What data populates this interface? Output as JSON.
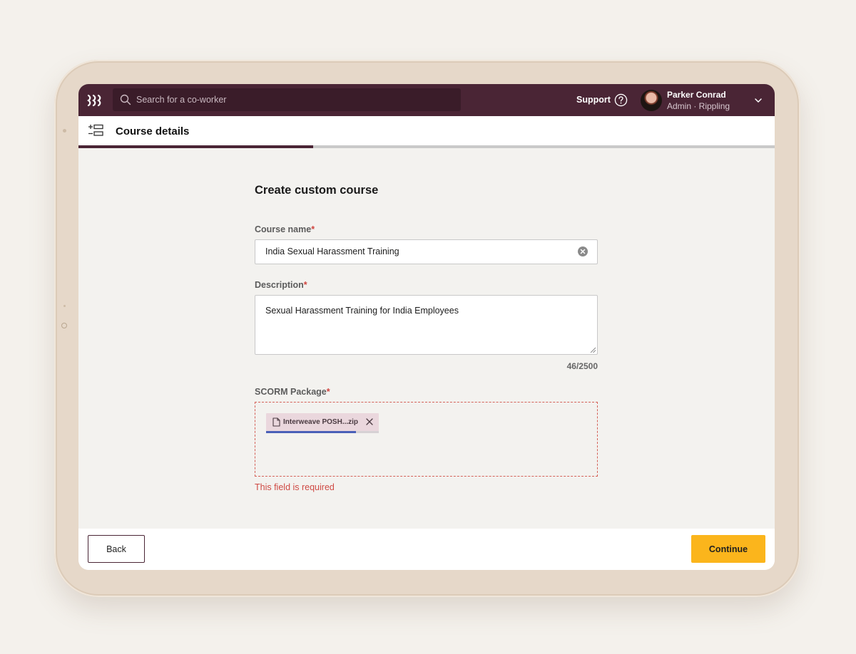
{
  "topbar": {
    "search_placeholder": "Search for a co-worker",
    "support_label": "Support",
    "user": {
      "name": "Parker Conrad",
      "role": "Admin · Rippling"
    }
  },
  "subheader": {
    "title": "Course details"
  },
  "progress": {
    "step_fraction": 0.337
  },
  "form": {
    "title": "Create custom course",
    "course_name": {
      "label": "Course name",
      "required_mark": "*",
      "value": "India Sexual Harassment Training"
    },
    "description": {
      "label": "Description",
      "required_mark": "*",
      "value": "Sexual Harassment Training for India Employees",
      "char_count": "46/2500"
    },
    "scorm": {
      "label": "SCORM Package",
      "required_mark": "*",
      "file": {
        "name": "Interweave POSH...zip",
        "upload_progress": 0.8
      },
      "error": "This field is required"
    }
  },
  "footer": {
    "back_label": "Back",
    "continue_label": "Continue"
  },
  "colors": {
    "brand": "#4a2535",
    "accent": "#fbb51c",
    "error": "#d0453f",
    "upload_progress": "#4a60b8"
  }
}
